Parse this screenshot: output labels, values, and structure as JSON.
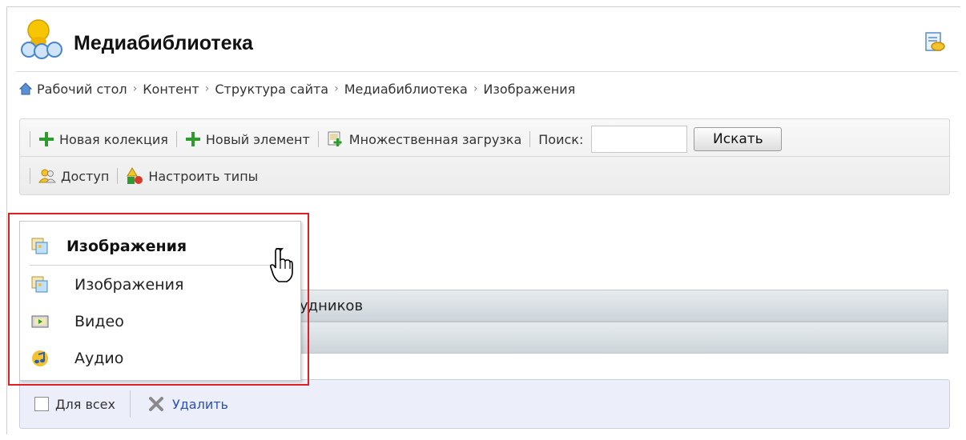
{
  "header": {
    "title": "Медиабиблиотека"
  },
  "breadcrumb": {
    "items": [
      "Рабочий стол",
      "Контент",
      "Структура сайта",
      "Медиабиблиотека",
      "Изображения"
    ],
    "separator": "›"
  },
  "toolbar": {
    "new_collection": "Новая колекция",
    "new_element": "Новый элемент",
    "bulk_upload": "Множественная загрузка",
    "search_label": "Поиск:",
    "search_value": "",
    "search_button": "Искать",
    "access": "Доступ",
    "configure_types": "Настроить типы"
  },
  "dropdown": {
    "selected": "Изображения",
    "options": [
      "Изображения",
      "Видео",
      "Аудио"
    ]
  },
  "background_rows": {
    "row1_text": "удников"
  },
  "footer": {
    "for_all": "Для всех",
    "delete": "Удалить"
  },
  "colors": {
    "accent_green": "#2e9b2e",
    "highlight_red": "#e02020",
    "link_blue": "#2b4fb8"
  }
}
